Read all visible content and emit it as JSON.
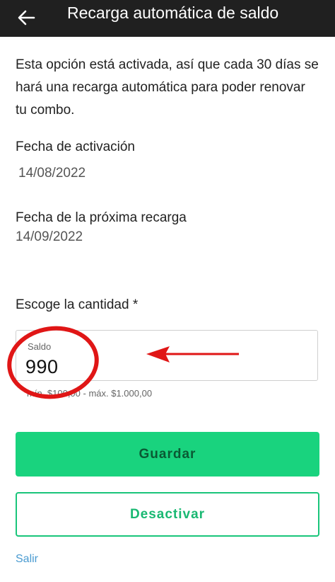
{
  "header": {
    "title": "Recarga automática de saldo",
    "back_icon": "arrow-left-icon"
  },
  "intro_text": "Esta opción está activada, así que cada 30 días se hará una recarga automática para poder renovar tu combo.",
  "activation": {
    "label": "Fecha de activación",
    "value": "14/08/2022"
  },
  "next_recharge": {
    "label": "Fecha de la próxima recarga",
    "value": "14/09/2022"
  },
  "amount": {
    "label": "Escoge la cantidad *",
    "field_label": "Saldo",
    "field_value": "990",
    "hint": "mín. $100,00 - máx. $1.000,00"
  },
  "buttons": {
    "save": "Guardar",
    "deactivate": "Desactivar",
    "exit": "Salir"
  },
  "colors": {
    "header_bg": "#202020",
    "accent_green": "#19d37e",
    "annotation_red": "#e01616",
    "link_blue": "#4a9bd1"
  }
}
